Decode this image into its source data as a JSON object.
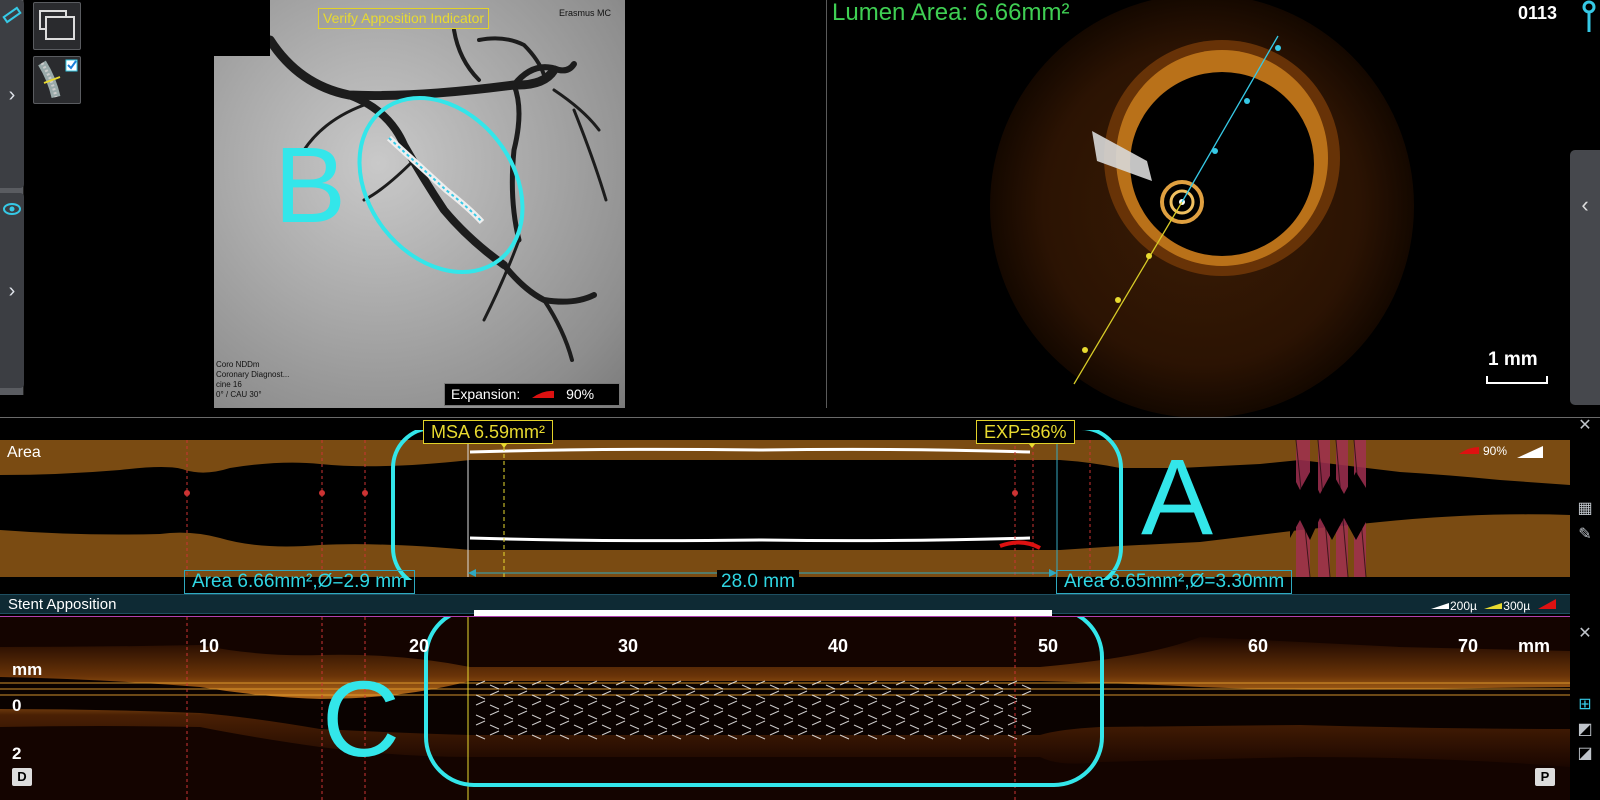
{
  "angiography": {
    "title": "Verify Apposition Indicator",
    "corner_text": "Erasmus MC",
    "info_lines": [
      "Coro NDDm",
      "Coronary Diagnost...",
      "cine 16",
      "0° / CAU 30°"
    ],
    "expansion_label": "Expansion:",
    "expansion_value": "90%",
    "overlay_label": "B"
  },
  "oct": {
    "lumen_area": "Lumen Area: 6.66mm²",
    "frame_number": "0113",
    "scale": "1 mm"
  },
  "area_panel": {
    "label": "Area",
    "msa": "MSA 6.59mm²",
    "exp": "EXP=86%",
    "left_measure": "Area 6.66mm²,Ø=2.9 mm",
    "right_measure": "Area 8.65mm²,Ø=3.30mm",
    "stent_length": "28.0 mm",
    "legend_value": "90%",
    "overlay_label": "A"
  },
  "apposition": {
    "title": "Stent Apposition",
    "legend_1": "200µ",
    "legend_2": "300µ"
  },
  "longitudinal": {
    "ticks": [
      "10",
      "20",
      "30",
      "40",
      "50",
      "60",
      "70"
    ],
    "unit": "mm",
    "depth_unit": "mm",
    "depth_0": "0",
    "depth_2": "2",
    "distal_tag": "D",
    "proximal_tag": "P",
    "overlay_label": "C"
  },
  "colors": {
    "accent_cyan": "#33e6ea",
    "highlight_yellow": "#e8da30",
    "lumen_green": "#3fcf53",
    "area_brown": "#7a4b12"
  },
  "icons": {
    "ruler": "ruler-icon",
    "eye": "eye-icon",
    "wrench": "wrench-icon",
    "close": "close-icon"
  }
}
